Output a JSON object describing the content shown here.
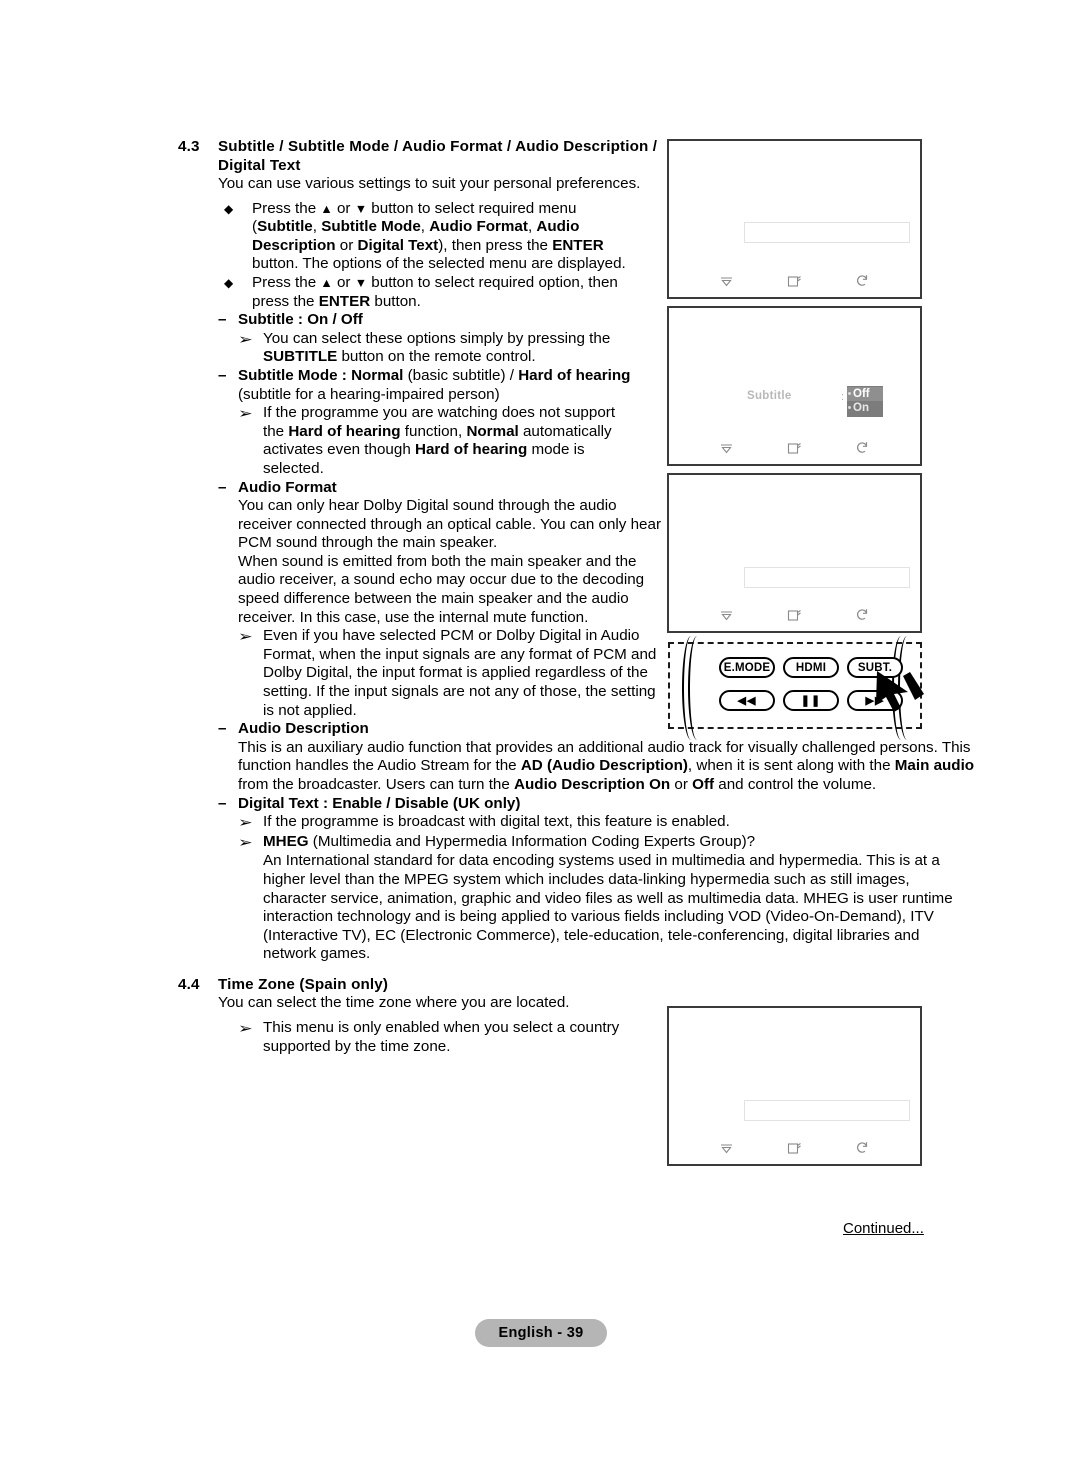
{
  "document": {
    "footer_page_label": "English - 39",
    "continued_label": "Continued..."
  },
  "sections": [
    {
      "number": "4.3",
      "title": "Subtitle / Subtitle Mode / Audio Format / Audio Description / Digital Text",
      "intro": "You can use various settings to suit your personal preferences."
    },
    {
      "number": "4.4",
      "title": "Time Zone (Spain only)",
      "intro": "You can select the time zone where you are located."
    }
  ],
  "body": {
    "bullet1_line1": "Press the ",
    "bullet1_arrows": " or ",
    "bullet1_line1b": " button to select required menu",
    "bullet1_line2_pre": "(",
    "bullet1_menu1": "Subtitle",
    "bullet1_menu2": "Subtitle Mode",
    "bullet1_menu3": "Audio Format",
    "bullet1_menu4": "Audio Description",
    "bullet1_or": " or ",
    "bullet1_menu5": "Digital Text",
    "bullet1_line2_post": "), then press the ",
    "bullet1_enter": "ENTER",
    "bullet1_line3": "button. The options of the selected menu are displayed.",
    "bullet2_line1": " button to select required option, then",
    "bullet2_line2_pre": "press the ",
    "bullet2_enter": "ENTER",
    "bullet2_line2_post": " button.",
    "subtitle_head_label": "Subtitle",
    "subtitle_head_rest": " : ",
    "subtitle_head_values": "On / Off",
    "subtitle_note_line1": "You can select these options simply by pressing the",
    "subtitle_note_bold": "SUBTITLE",
    "subtitle_note_line2": " button on the remote control.",
    "submode_head_label": "Subtitle Mode",
    "submode_head_sep": " : ",
    "submode_normal": "Normal",
    "submode_normal_paren": " (basic subtitle) / ",
    "submode_hoh": "Hard of hearing",
    "submode_paren2": "(subtitle for a hearing-impaired person)",
    "submode_note1": "If the programme you are watching does not support",
    "submode_note2_pre": "the ",
    "submode_note2_hoh": "Hard of hearing",
    "submode_note2_mid": " function, ",
    "submode_note2_normal": "Normal",
    "submode_note2_post": " automatically",
    "submode_note3_pre": "activates even though ",
    "submode_note3_hoh": "Hard of hearing",
    "submode_note3_post": " mode is",
    "submode_note4": "selected.",
    "audioformat_head": "Audio Format",
    "audioformat_p1": "You can only hear Dolby Digital sound through the audio receiver connected through an optical cable. You can only hear PCM sound through the main speaker.",
    "audioformat_p2": "When sound is emitted from both the main speaker and the audio receiver, a sound echo may occur due to the decoding speed difference between the main speaker and the audio receiver. In this case, use the internal mute function.",
    "audioformat_note": "Even if you have selected PCM or Dolby Digital in Audio Format, when the input signals are any format of PCM and Dolby Digital, the input format is applied regardless of the setting. If the input signals are not any of those, the setting is not applied.",
    "audiodesc_head": "Audio Description",
    "audiodesc_p_1": "This is an auxiliary audio function that provides an additional audio track for visually challenged persons. This function handles the Audio Stream for the ",
    "audiodesc_ad_bold": "AD (Audio Description)",
    "audiodesc_p_2": ", when it is sent along with the ",
    "audiodesc_main_bold": "Main audio",
    "audiodesc_p_3": " from the broadcaster. Users can turn the ",
    "audiodesc_desc_bold": "Audio Description",
    "audiodesc_on_bold": "On",
    "audiodesc_p_4": " or ",
    "audiodesc_off_bold": "Off",
    "audiodesc_p_5": " and control the volume.",
    "digitaltext_head_label": "Digital Text",
    "digitaltext_head_sep": " : ",
    "digitaltext_head_values": "Enable / Disable (UK only)",
    "digitaltext_note1": "If the programme is broadcast with digital text, this feature is enabled.",
    "digitaltext_note2_bold": "MHEG",
    "digitaltext_note2_rest": " (Multimedia and Hypermedia Information Coding Experts Group)?",
    "digitaltext_note3": "An International standard for data encoding systems used in multimedia and hypermedia. This is at a higher level than the MPEG system which includes data-linking hypermedia such as still images, character service, animation, graphic and video files as well as multimedia data. MHEG is user runtime interaction technology and is being applied to various fields including VOD (Video-On-Demand), ITV (Interactive TV), EC (Electronic Commerce), tele-education, tele-conferencing, digital libraries and network games.",
    "timezone_note": "This menu is only enabled when you select a country supported by the time zone."
  },
  "screens": [
    {
      "id": "screen-menu-1",
      "has_menu_bar": true,
      "label": "",
      "options": [],
      "footer_icons": [
        "move-down-icon",
        "enter-icon",
        "return-icon"
      ]
    },
    {
      "id": "screen-subtitle",
      "has_menu_bar": false,
      "label": "Subtitle",
      "colon": ":",
      "options": [
        {
          "label": "Off",
          "selected": true
        },
        {
          "label": "On",
          "selected": false
        }
      ],
      "footer_icons": [
        "move-down-icon",
        "enter-icon",
        "return-icon"
      ]
    },
    {
      "id": "screen-menu-2",
      "has_menu_bar": true,
      "label": "",
      "options": [],
      "footer_icons": [
        "move-down-icon",
        "enter-icon",
        "return-icon"
      ]
    },
    {
      "id": "screen-timezone",
      "has_menu_bar": true,
      "label": "",
      "options": [],
      "footer_icons": [
        "move-down-icon",
        "enter-icon",
        "return-icon"
      ]
    }
  ],
  "remote": {
    "buttons_row1": [
      "E.MODE",
      "HDMI",
      "SUBT."
    ],
    "buttons_row2": [
      "◀◀",
      "❚❚",
      "▶▶"
    ],
    "pointer": "cursor-arrow"
  },
  "glyphs": {
    "up": "▲",
    "down": "▼",
    "dash": "–",
    "diamond": "◆",
    "arrow": "➢"
  }
}
